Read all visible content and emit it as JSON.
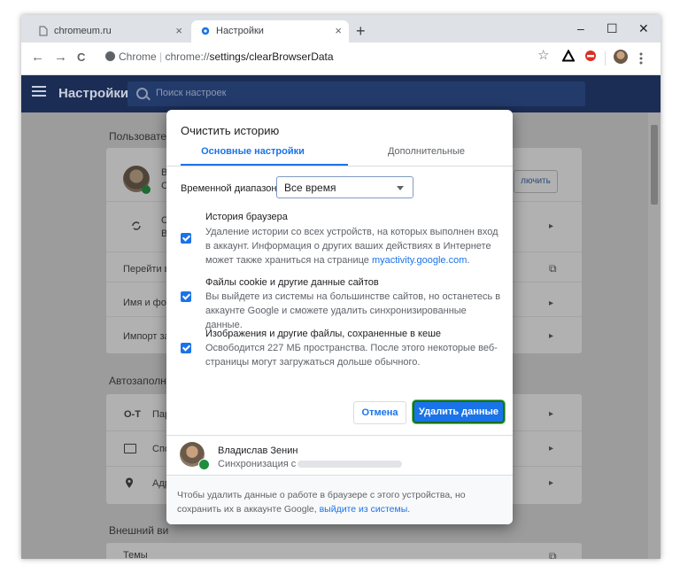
{
  "tabs": [
    {
      "label": "chromeum.ru",
      "close": "×"
    },
    {
      "label": "Настройки",
      "close": "×"
    }
  ],
  "window_controls": {
    "minimize": "–",
    "maximize": "☐",
    "close": "✕",
    "new_tab": "+"
  },
  "nav": {
    "back": "←",
    "forward": "→",
    "reload": "C"
  },
  "omnibox": {
    "site": "Chrome",
    "separator": " | ",
    "scheme": "chrome://",
    "path": "settings/clearBrowserData",
    "star": "☆"
  },
  "settings_header": {
    "title": "Настройки",
    "search_placeholder": "Поиск настроек"
  },
  "background": {
    "section_people": "Пользовате",
    "card_left_letters": [
      "В",
      "С",
      "С",
      "В"
    ],
    "btn_sync_off": "лючить",
    "row_goto": "Перейти в",
    "row_name": "Имя и фот",
    "row_import": "Импорт за",
    "section_autofill": "Автозаполн",
    "row_passwords": "Пар",
    "row_payments": "Спо",
    "row_addresses": "Адр",
    "section_appearance": "Внешний ви",
    "row_themes": "Темы",
    "chevron": "▸",
    "external": "⧉"
  },
  "dialog": {
    "title": "Очистить историю",
    "tabs": [
      "Основные настройки",
      "Дополнительные"
    ],
    "range_label": "Временной диапазон",
    "range_value": "Все время",
    "options": [
      {
        "title": "История браузера",
        "description": "Удаление истории со всех устройств, на которых выполнен вход в аккаунт. Информация о других ваших действиях в Интернете может также храниться на странице ",
        "link": "myactivity.google.com",
        "after_link": ".",
        "checked": true
      },
      {
        "title": "Файлы cookie и другие данные сайтов",
        "description": "Вы выйдете из системы на большинстве сайтов, но останетесь в аккаунте Google и сможете удалить синхронизированные данные.",
        "checked": true
      },
      {
        "title": "Изображения и другие файлы, сохраненные в кеше",
        "description": "Освободится 227 МБ пространства. После этого некоторые веб-страницы могут загружаться дольше обычного.",
        "checked": true
      }
    ],
    "cancel": "Отмена",
    "delete": "Удалить данные",
    "user_name": "Владислав Зенин",
    "sync_text": "Синхронизация с",
    "footer_text": "Чтобы удалить данные о работе в браузере с этого устройства, но сохранить их в аккаунте Google, ",
    "footer_link": "выйдите из системы",
    "footer_end": "."
  },
  "colors": {
    "accent": "#1a73e8",
    "header": "#1b2d55",
    "overlay": "#9c9c9c",
    "highlight": "#1a6f1a"
  }
}
